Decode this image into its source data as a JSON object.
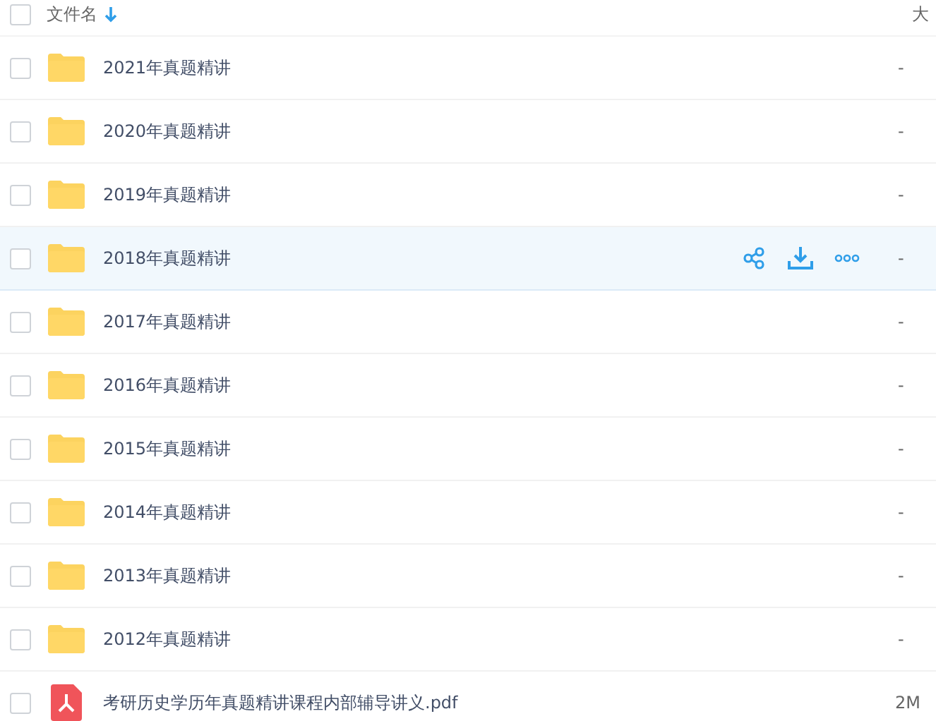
{
  "header": {
    "select_all_checked": false,
    "name_label": "文件名",
    "size_label": "大"
  },
  "rows": [
    {
      "kind": "folder",
      "name": "2021年真题精讲",
      "size": "-",
      "checked": false,
      "hovered": false
    },
    {
      "kind": "folder",
      "name": "2020年真题精讲",
      "size": "-",
      "checked": false,
      "hovered": false
    },
    {
      "kind": "folder",
      "name": "2019年真题精讲",
      "size": "-",
      "checked": false,
      "hovered": false
    },
    {
      "kind": "folder",
      "name": "2018年真题精讲",
      "size": "-",
      "checked": false,
      "hovered": true
    },
    {
      "kind": "folder",
      "name": "2017年真题精讲",
      "size": "-",
      "checked": false,
      "hovered": false
    },
    {
      "kind": "folder",
      "name": "2016年真题精讲",
      "size": "-",
      "checked": false,
      "hovered": false
    },
    {
      "kind": "folder",
      "name": "2015年真题精讲",
      "size": "-",
      "checked": false,
      "hovered": false
    },
    {
      "kind": "folder",
      "name": "2014年真题精讲",
      "size": "-",
      "checked": false,
      "hovered": false
    },
    {
      "kind": "folder",
      "name": "2013年真题精讲",
      "size": "-",
      "checked": false,
      "hovered": false
    },
    {
      "kind": "folder",
      "name": "2012年真题精讲",
      "size": "-",
      "checked": false,
      "hovered": false
    },
    {
      "kind": "pdf",
      "name": "考研历史学历年真题精讲课程内部辅导讲义.pdf",
      "size": "2M",
      "checked": false,
      "hovered": false
    }
  ]
}
